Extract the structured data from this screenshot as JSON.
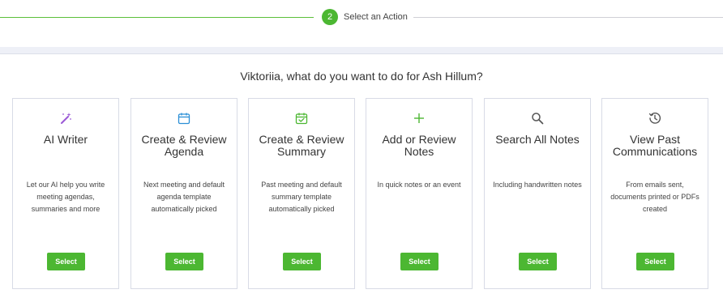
{
  "stepper": {
    "step_number": "2",
    "step_label": "Select an Action"
  },
  "prompt": "Viktoriia, what do you want to do for Ash Hillum?",
  "cards": [
    {
      "icon": "magic-wand-icon",
      "icon_color": "#9b59d6",
      "title": "AI Writer",
      "description": "Let our AI help you write meeting agendas, summaries and more",
      "button": "Select"
    },
    {
      "icon": "calendar-icon",
      "icon_color": "#2b8fd6",
      "title": "Create & Review Agenda",
      "description": "Next meeting and default agenda template automatically picked",
      "button": "Select"
    },
    {
      "icon": "calendar-check-icon",
      "icon_color": "#4cb732",
      "title": "Create & Review Summary",
      "description": "Past meeting and default summary template automatically picked",
      "button": "Select"
    },
    {
      "icon": "plus-icon",
      "icon_color": "#4cb732",
      "title": "Add or Review Notes",
      "description": "In quick notes or an event",
      "button": "Select"
    },
    {
      "icon": "search-icon",
      "icon_color": "#555555",
      "title": "Search All Notes",
      "description": "Including handwritten notes",
      "button": "Select"
    },
    {
      "icon": "clock-history-icon",
      "icon_color": "#555555",
      "title": "View Past Communications",
      "description": "From emails sent, documents printed or PDFs created",
      "button": "Select"
    }
  ]
}
